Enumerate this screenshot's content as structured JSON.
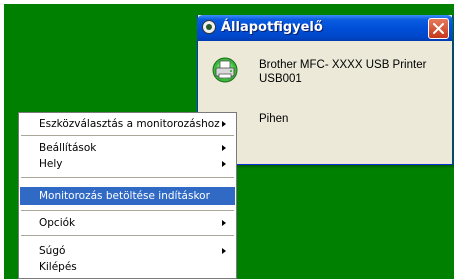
{
  "window": {
    "title": "Állapotfigyelő",
    "device_name": "Brother MFC- XXXX  USB Printer USB001",
    "status": "Pihen",
    "icons": {
      "title": "monitor-icon",
      "close": "close-icon",
      "device": "printer-icon"
    },
    "colors": {
      "title_bar": "#0050d8",
      "close": "#c5371c",
      "body": "#ece9d8"
    }
  },
  "desktop": {
    "background": "#008000"
  },
  "menu": {
    "items": [
      {
        "label": "Eszközválasztás a monitorozáshoz",
        "submenu": true
      },
      {
        "label": "Beállítások",
        "submenu": true
      },
      {
        "label": "Hely",
        "submenu": true
      },
      {
        "label": "Monitorozás betöltése indításkor",
        "submenu": false,
        "highlighted": true
      },
      {
        "label": "Opciók",
        "submenu": true
      },
      {
        "label": "Súgó",
        "submenu": true
      },
      {
        "label": "Kilépés",
        "submenu": false
      }
    ],
    "highlight_color": "#316ac5"
  }
}
